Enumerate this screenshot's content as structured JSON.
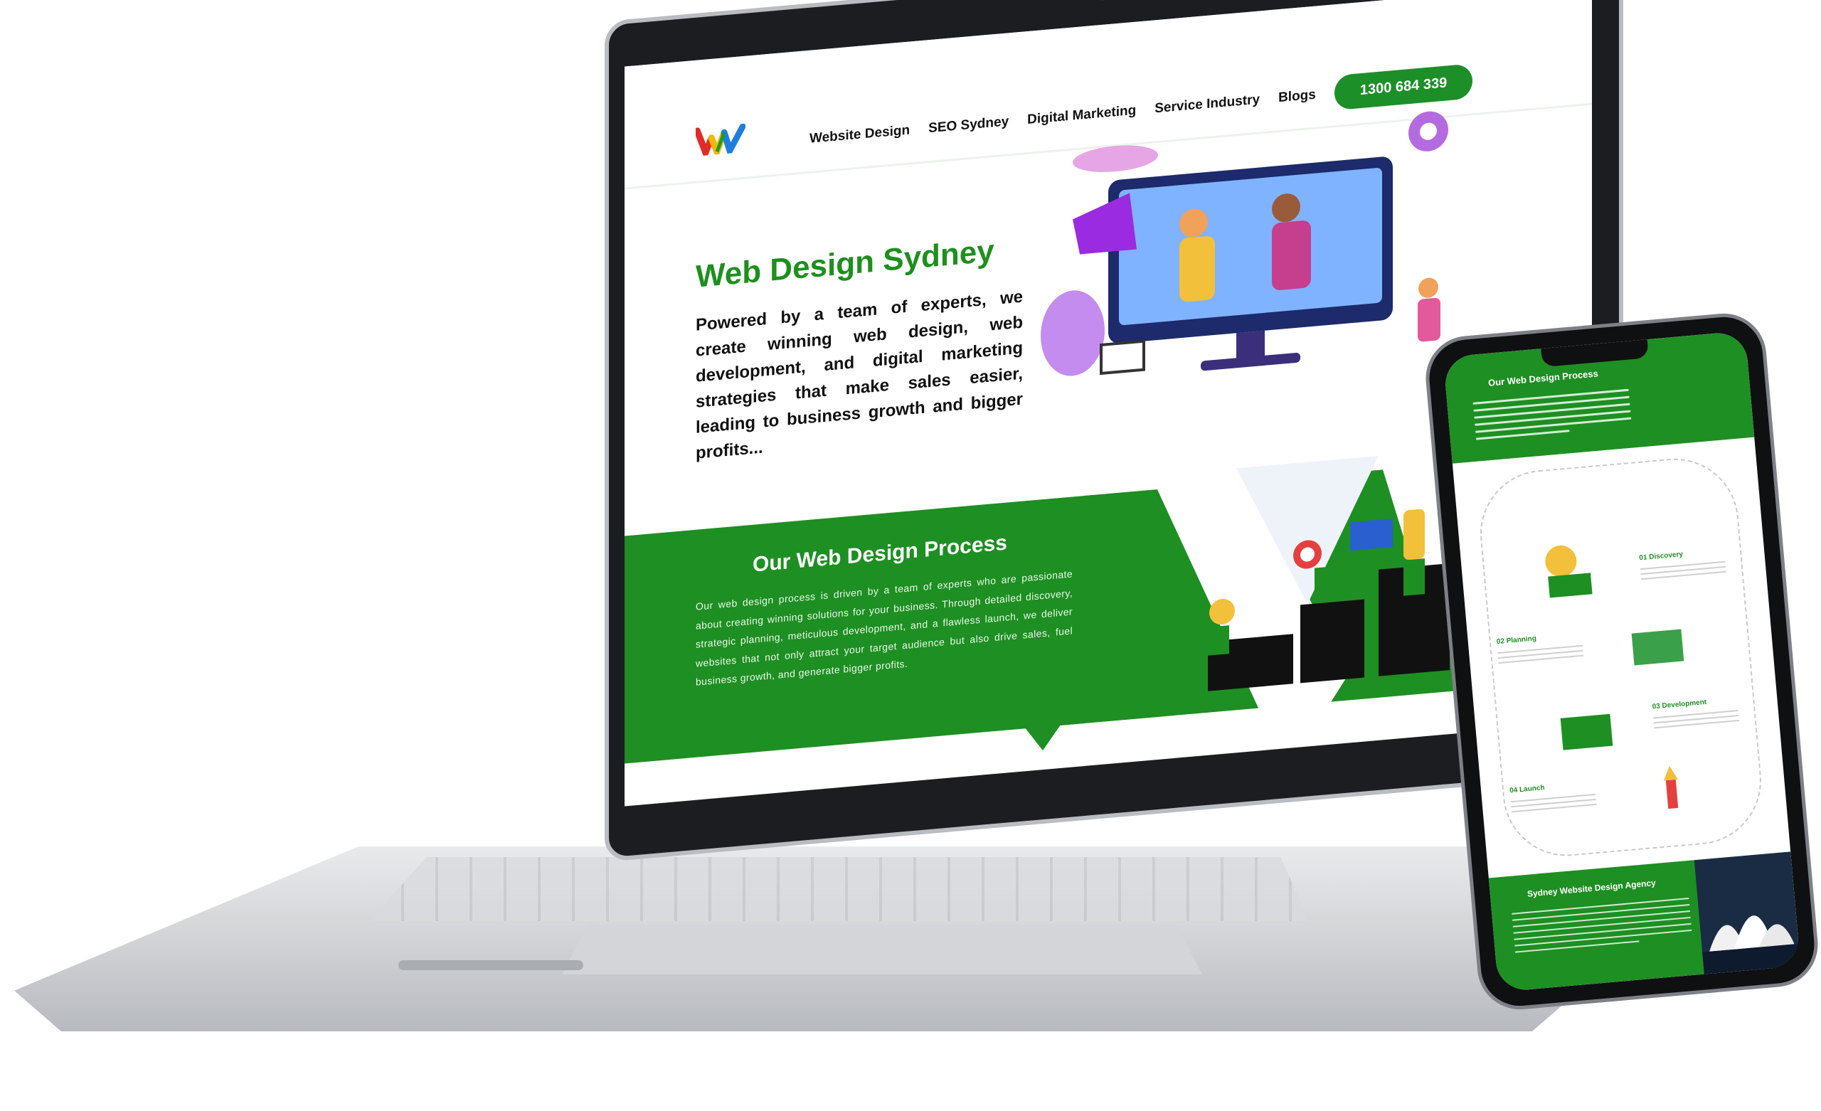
{
  "nav": {
    "items": [
      "Website Design",
      "SEO Sydney",
      "Digital Marketing",
      "Service Industry",
      "Blogs"
    ],
    "phone": "1300 684 339"
  },
  "hero": {
    "title": "Web Design Sydney",
    "text": "Powered by a team of experts, we create winning web design, web development, and digital marketing strategies that make sales easier, leading to business growth and bigger profits..."
  },
  "process": {
    "title": "Our Web Design Process",
    "text": "Our web design process is driven by a team of experts who are passionate about creating winning solutions for your business. Through detailed discovery, strategic planning, meticulous development, and a flawless launch, we deliver websites that not only attract your target audience but also drive sales, fuel business growth, and generate bigger profits."
  },
  "phone": {
    "heading": "Our Web Design Process",
    "steps": [
      "01 Discovery",
      "02 Planning",
      "03 Development",
      "04 Launch"
    ],
    "agency_heading": "Sydney Website Design Agency"
  },
  "colors": {
    "brand_green": "#1e8f22",
    "text": "#111111"
  },
  "icons": [
    "logo-w-icon",
    "camera-icon"
  ]
}
